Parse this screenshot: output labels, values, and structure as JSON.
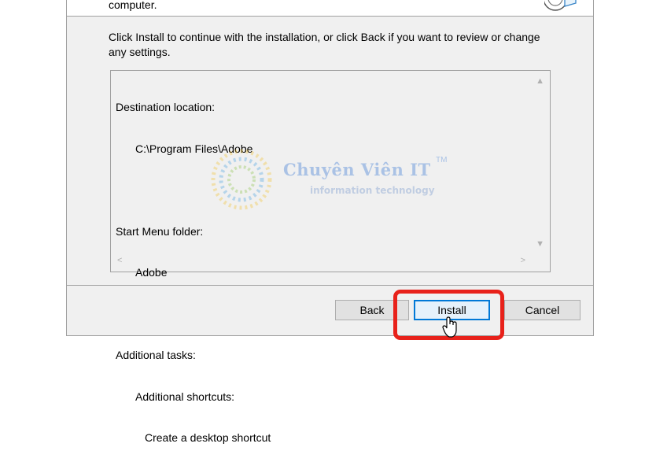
{
  "header": {
    "text": "computer."
  },
  "instructions": {
    "text": "Click Install to continue with the installation, or click Back if you want to review or change any settings."
  },
  "memo": {
    "destination_label": "Destination location:",
    "destination_value": "C:\\Program Files\\Adobe",
    "start_menu_label": "Start Menu folder:",
    "start_menu_value": "Adobe",
    "tasks_label": "Additional tasks:",
    "shortcuts_label": "Additional shortcuts:",
    "shortcut_item": "Create a desktop shortcut"
  },
  "watermark": {
    "title": "Chuyên Viên IT",
    "tm": "TM",
    "subtitle": "information technology"
  },
  "buttons": {
    "back": "Back",
    "install": "Install",
    "cancel": "Cancel"
  },
  "colors": {
    "highlight": "#e8211a",
    "focus_border": "#0078d7",
    "dialog_bg": "#f0f0f0"
  },
  "icons": {
    "setup": "setup-disc-icon",
    "cursor": "mouse-pointer-icon"
  }
}
